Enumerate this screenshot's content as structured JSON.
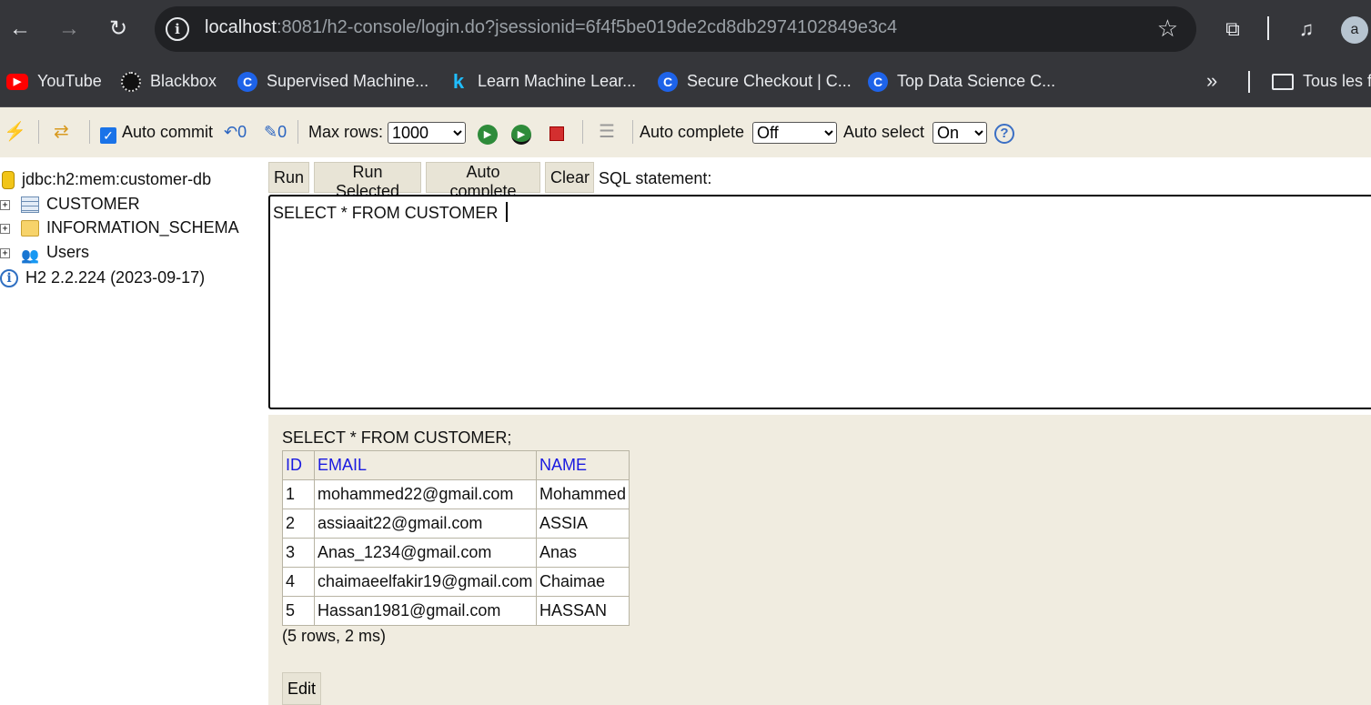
{
  "browser": {
    "url_host": "localhost",
    "url_rest": ":8081/h2-console/login.do?jsessionid=6f4f5be019de2cd8db2974102849e3c4",
    "avatar_letter": "a",
    "bookmarks": [
      {
        "label": "YouTube",
        "icon": "youtube-icon"
      },
      {
        "label": "Blackbox",
        "icon": "blackbox-icon"
      },
      {
        "label": "Supervised Machine...",
        "icon": "c-site-icon"
      },
      {
        "label": "Learn Machine Lear...",
        "icon": "kaggle-icon"
      },
      {
        "label": "Secure Checkout | C...",
        "icon": "c-site-icon"
      },
      {
        "label": "Top Data Science C...",
        "icon": "c-site-icon"
      }
    ],
    "more": "»",
    "all_bookmarks": "Tous les f"
  },
  "toolbar": {
    "auto_commit": "Auto commit",
    "max_rows_label": "Max rows:",
    "max_rows_value": "1000",
    "auto_complete_label": "Auto complete",
    "auto_complete_value": "Off",
    "auto_select_label": "Auto select",
    "auto_select_value": "On"
  },
  "tree": {
    "connection": "jdbc:h2:mem:customer-db",
    "items": [
      "CUSTOMER",
      "INFORMATION_SCHEMA",
      "Users"
    ],
    "version": "H2 2.2.224 (2023-09-17)"
  },
  "query": {
    "run": "Run",
    "run_selected": "Run Selected",
    "auto_complete": "Auto complete",
    "clear": "Clear",
    "sql_label": "SQL statement:",
    "sql_text": "SELECT * FROM CUSTOMER "
  },
  "result": {
    "statement": "SELECT * FROM CUSTOMER;",
    "columns": [
      "ID",
      "EMAIL",
      "NAME"
    ],
    "rows": [
      [
        "1",
        "mohammed22@gmail.com",
        "Mohammed"
      ],
      [
        "2",
        "assiaait22@gmail.com",
        "ASSIA"
      ],
      [
        "3",
        "Anas_1234@gmail.com",
        "Anas"
      ],
      [
        "4",
        "chaimaeelfakir19@gmail.com",
        "Chaimae"
      ],
      [
        "5",
        "Hassan1981@gmail.com",
        "HASSAN"
      ]
    ],
    "summary": "(5 rows, 2 ms)",
    "edit": "Edit"
  },
  "colors": {
    "chrome": "#35363a",
    "panel": "#f0ece0",
    "header_link": "#1a1ae0"
  }
}
